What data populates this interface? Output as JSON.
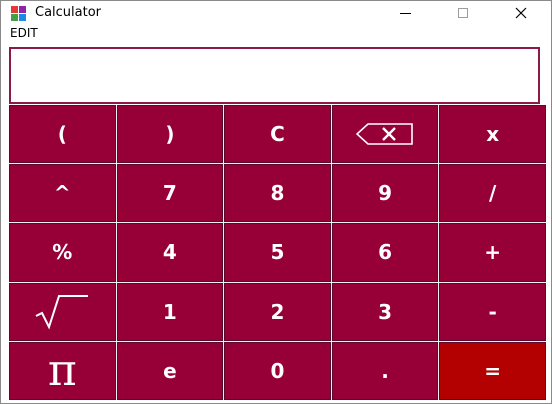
{
  "window": {
    "title": "Calculator",
    "icon": "calculator-app-icon",
    "icon_colors": [
      "#e53935",
      "#8e24aa",
      "#43a047",
      "#1e88e5"
    ]
  },
  "menu": {
    "items": [
      {
        "label": "EDIT"
      }
    ]
  },
  "display": {
    "value": "",
    "border_color": "#8b1a4a"
  },
  "colors": {
    "key_background": "#960037",
    "equals_background": "#b30000",
    "key_text": "#ffffff"
  },
  "keys": [
    {
      "name": "open-paren-button",
      "label": "("
    },
    {
      "name": "close-paren-button",
      "label": ")"
    },
    {
      "name": "clear-button",
      "label": "C"
    },
    {
      "name": "backspace-button",
      "icon": "backspace-icon"
    },
    {
      "name": "multiply-button",
      "label": "x"
    },
    {
      "name": "power-button",
      "label": "^"
    },
    {
      "name": "digit-7-button",
      "label": "7"
    },
    {
      "name": "digit-8-button",
      "label": "8"
    },
    {
      "name": "digit-9-button",
      "label": "9"
    },
    {
      "name": "divide-button",
      "label": "/"
    },
    {
      "name": "percent-button",
      "label": "%"
    },
    {
      "name": "digit-4-button",
      "label": "4"
    },
    {
      "name": "digit-5-button",
      "label": "5"
    },
    {
      "name": "digit-6-button",
      "label": "6"
    },
    {
      "name": "plus-button",
      "label": "+"
    },
    {
      "name": "sqrt-button",
      "icon": "square-root-icon"
    },
    {
      "name": "digit-1-button",
      "label": "1"
    },
    {
      "name": "digit-2-button",
      "label": "2"
    },
    {
      "name": "digit-3-button",
      "label": "3"
    },
    {
      "name": "minus-button",
      "label": "-"
    },
    {
      "name": "pi-button",
      "label": "π"
    },
    {
      "name": "euler-e-button",
      "label": "e"
    },
    {
      "name": "digit-0-button",
      "label": "0"
    },
    {
      "name": "decimal-point-button",
      "label": "."
    },
    {
      "name": "equals-button",
      "label": "="
    }
  ]
}
